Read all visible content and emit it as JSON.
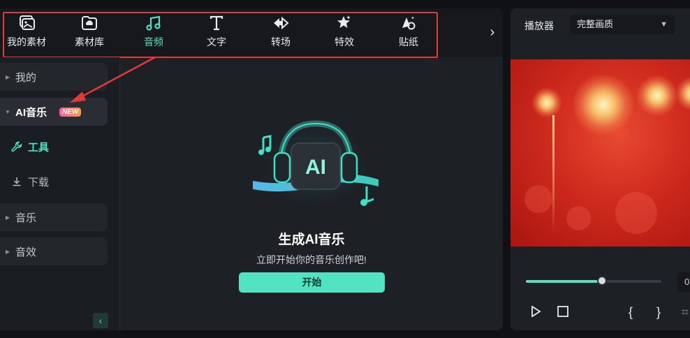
{
  "toolbar": {
    "tools": [
      {
        "label": "我的素材",
        "icon": "my-media-icon"
      },
      {
        "label": "素材库",
        "icon": "stock-library-icon"
      },
      {
        "label": "音频",
        "icon": "music-note-icon",
        "active": true
      },
      {
        "label": "文字",
        "icon": "text-icon"
      },
      {
        "label": "转场",
        "icon": "transition-icon"
      },
      {
        "label": "特效",
        "icon": "effects-icon"
      },
      {
        "label": "贴纸",
        "icon": "sticker-icon"
      }
    ],
    "scroll_right": "›"
  },
  "sidebar": {
    "items": [
      {
        "label": "我的"
      },
      {
        "label": "AI音乐",
        "badge": "NEW"
      },
      {
        "label": "工具"
      },
      {
        "label": "下载"
      },
      {
        "label": "音乐"
      },
      {
        "label": "音效"
      }
    ],
    "collapse": "‹"
  },
  "content": {
    "title": "生成AI音乐",
    "subtitle": "立即开始你的音乐创作吧!",
    "start_button": "开始",
    "hero_text": "AI"
  },
  "player": {
    "label": "播放器",
    "quality": "完整画质",
    "progress": 0.56,
    "time_prefix": "0"
  },
  "colors": {
    "accent": "#4fe3c1",
    "highlight": "#e53a3a"
  }
}
